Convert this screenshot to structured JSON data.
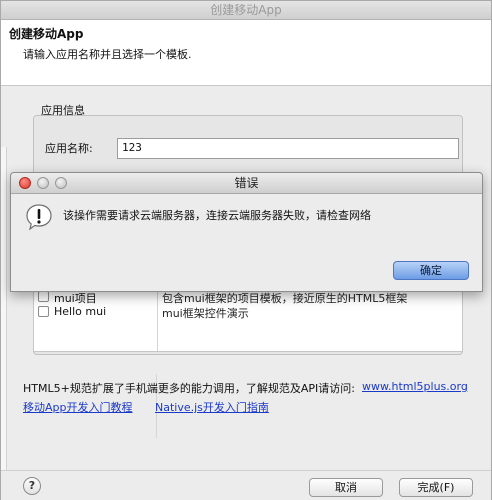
{
  "window": {
    "title": "创建移动App",
    "header_title": "创建移动App",
    "header_desc": "请输入应用名称并且选择一个模板."
  },
  "app_info": {
    "group_title": "应用信息",
    "name_label": "应用名称:",
    "name_value": "123"
  },
  "templates": {
    "rows": [
      {
        "name": "mui项目",
        "desc": "包含mui框架的项目模板，接近原生的HTML5框架"
      },
      {
        "name": "Hello mui",
        "desc": "mui框架控件演示"
      }
    ]
  },
  "info": {
    "text": "HTML5+规范扩展了手机端更多的能力调用，了解规范及API请访问:",
    "site_link": "www.html5plus.org",
    "link_tutorial": "移动App开发入门教程",
    "link_native": "Native.js开发入门指南"
  },
  "footer": {
    "help": "?",
    "cancel": "取消",
    "finish": "完成(F)"
  },
  "dialog": {
    "title": "错误",
    "message": "该操作需要请求云端服务器，连接云端服务器失败，请检查网络",
    "ok": "确定"
  },
  "colors": {
    "link": "#1b39c8",
    "close_button": "#d8362d",
    "ok_button": "#6d9ce6"
  }
}
